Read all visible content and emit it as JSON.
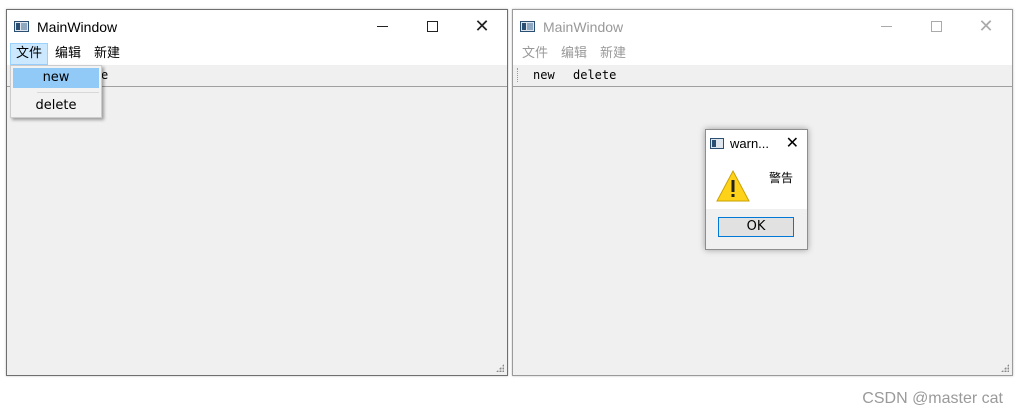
{
  "left_window": {
    "title": "MainWindow",
    "menu": [
      "文件",
      "编辑",
      "新建"
    ],
    "toolbar_visible_fragment": "e",
    "dropdown": [
      "new",
      "delete"
    ]
  },
  "right_window": {
    "title": "MainWindow",
    "menu": [
      "文件",
      "编辑",
      "新建"
    ],
    "toolbar": [
      "new",
      "delete"
    ]
  },
  "dialog": {
    "title": "warn...",
    "message": "警告",
    "ok_label": "OK",
    "icon": "warning-icon"
  },
  "window_controls": {
    "minimize": "minimize-icon",
    "maximize": "maximize-icon",
    "close": "✕"
  },
  "watermark": "CSDN @master cat",
  "colors": {
    "menu_highlight": "#91c9f7",
    "menu_active": "#cce8ff",
    "button_focus": "#0078d7",
    "warning": "#ffd21a"
  }
}
